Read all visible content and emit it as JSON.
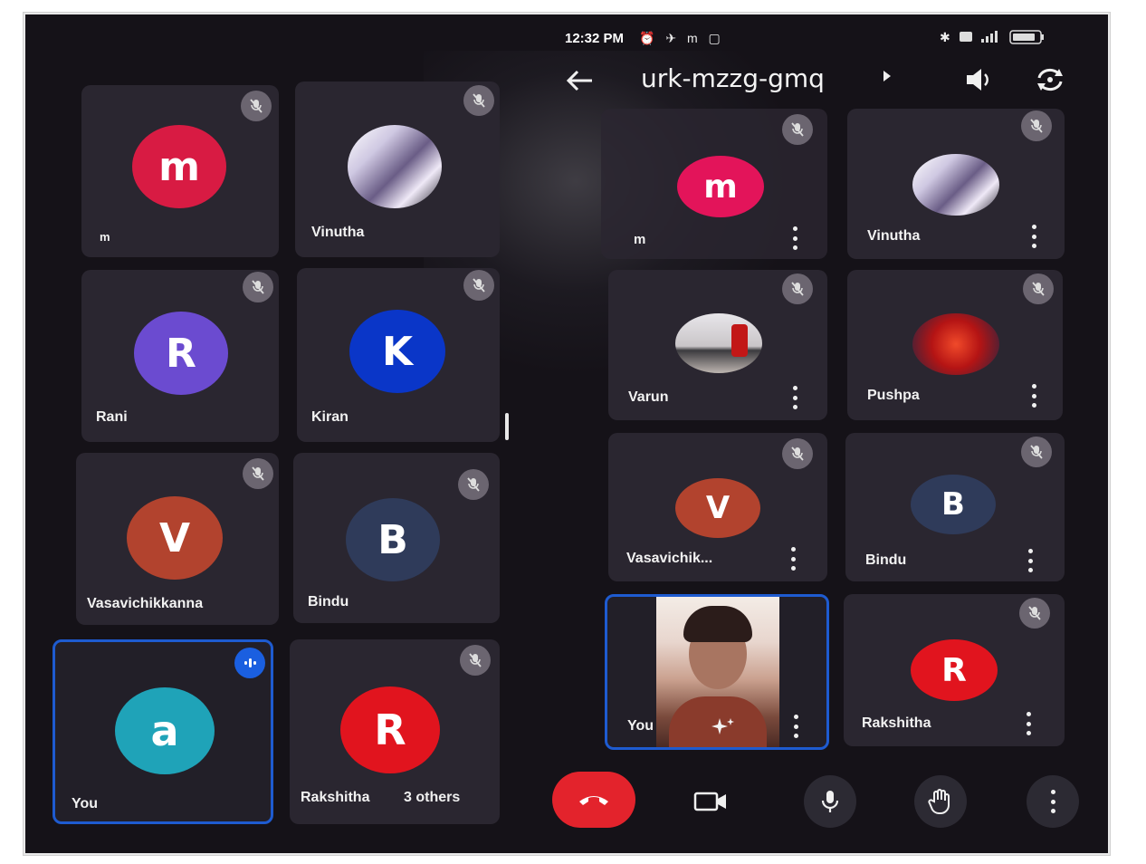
{
  "status_bar": {
    "time": "12:32 PM",
    "icons_text": "⏰ ✈ m ▢"
  },
  "top_bar": {
    "meeting_code": "urk-mzzg-gmq"
  },
  "left_grid": {
    "tiles": [
      {
        "name": "m",
        "initial": "m",
        "color": "#d81b43"
      },
      {
        "name": "Vinutha",
        "initial": "",
        "color": "#cfcfd8"
      },
      {
        "name": "Rani",
        "initial": "R",
        "color": "#6b4bd0"
      },
      {
        "name": "Kiran",
        "initial": "K",
        "color": "#0a36c8"
      },
      {
        "name": "Vasavichikkanna",
        "initial": "V",
        "color": "#b2432e"
      },
      {
        "name": "Bindu",
        "initial": "B",
        "color": "#2f3b5a"
      },
      {
        "name": "You",
        "initial": "a",
        "color": "#1fa3b8"
      },
      {
        "name": "Rakshitha",
        "initial": "R",
        "color": "#e1141e"
      }
    ],
    "others_label": "3 others"
  },
  "right_grid": {
    "tiles": [
      {
        "name": "m",
        "initial": "m",
        "color": "#e3145a"
      },
      {
        "name": "Vinutha",
        "initial": "",
        "color": "#cfcfd8"
      },
      {
        "name": "Varun",
        "initial": "",
        "color": "#b9b3b0"
      },
      {
        "name": "Pushpa",
        "initial": "",
        "color": "#a11c1c"
      },
      {
        "name": "Vasavichik...",
        "initial": "V",
        "color": "#b2432e"
      },
      {
        "name": "Bindu",
        "initial": "B",
        "color": "#2f3b5a"
      },
      {
        "name": "You",
        "initial": "",
        "color": "#d8c7c0"
      },
      {
        "name": "Rakshitha",
        "initial": "R",
        "color": "#e1141e"
      }
    ]
  },
  "colors": {
    "end_call": "#e3232c",
    "self_border": "#1e5bd0"
  },
  "icons": [
    "back-arrow-icon",
    "speaker-icon",
    "camera-flip-icon",
    "mic-off-icon",
    "more-vert-icon",
    "end-call-icon",
    "video-icon",
    "mic-icon",
    "raise-hand-icon",
    "sparkle-effects-icon"
  ]
}
